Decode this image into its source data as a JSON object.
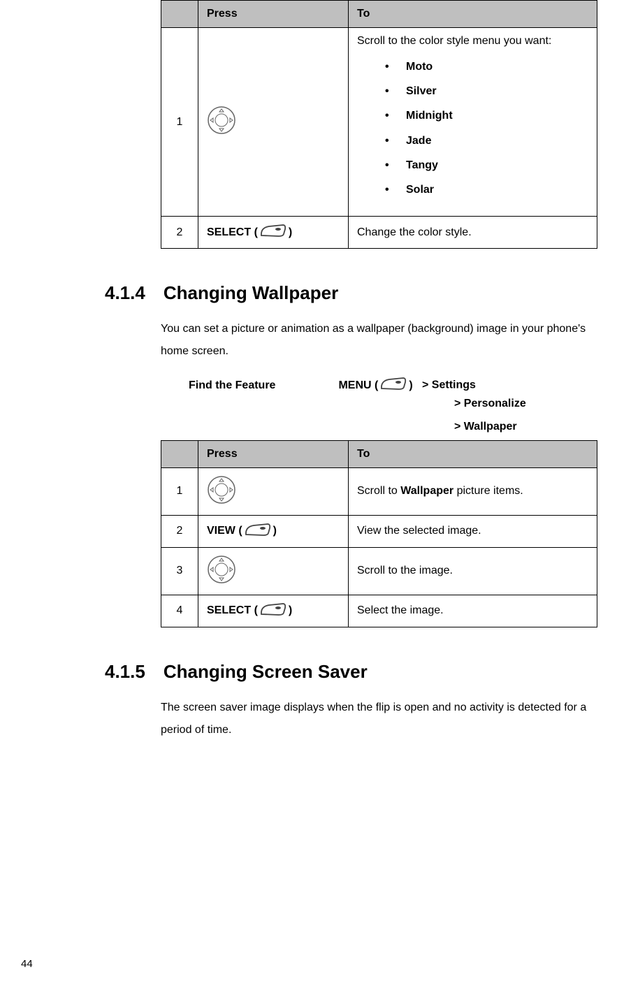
{
  "table1": {
    "headers": {
      "press": "Press",
      "to": "To"
    },
    "row1": {
      "num": "1",
      "to_intro": "Scroll to the color style menu you want:",
      "items": [
        "Moto",
        "Silver",
        "Midnight",
        "Jade",
        "Tangy",
        "Solar"
      ]
    },
    "row2": {
      "num": "2",
      "press_label": "SELECT (",
      "press_close": ")",
      "to": "Change the color style."
    }
  },
  "section414": {
    "heading": "4.1.4 Changing Wallpaper",
    "body": "You can set a picture or animation as a wallpaper (background) image in your phone's home screen.",
    "find_feature_label": "Find the Feature",
    "menu_label_prefix": "MENU (",
    "menu_label_suffix": ")",
    "path1": "> Settings",
    "path2": "> Personalize",
    "path3": "> Wallpaper"
  },
  "table2": {
    "headers": {
      "press": "Press",
      "to": "To"
    },
    "row1": {
      "num": "1",
      "to_pre": "Scroll to ",
      "to_bold": "Wallpaper",
      "to_post": " picture items."
    },
    "row2": {
      "num": "2",
      "press_label": "VIEW (",
      "press_close": ")",
      "to": "View the selected image."
    },
    "row3": {
      "num": "3",
      "to": "Scroll to the image."
    },
    "row4": {
      "num": "4",
      "press_label": "SELECT (",
      "press_close": ")",
      "to": "Select the image."
    }
  },
  "section415": {
    "heading": "4.1.5 Changing Screen Saver",
    "body": "The screen saver image displays when the flip is open and no activity is detected for a period of time."
  },
  "page_number": "44"
}
